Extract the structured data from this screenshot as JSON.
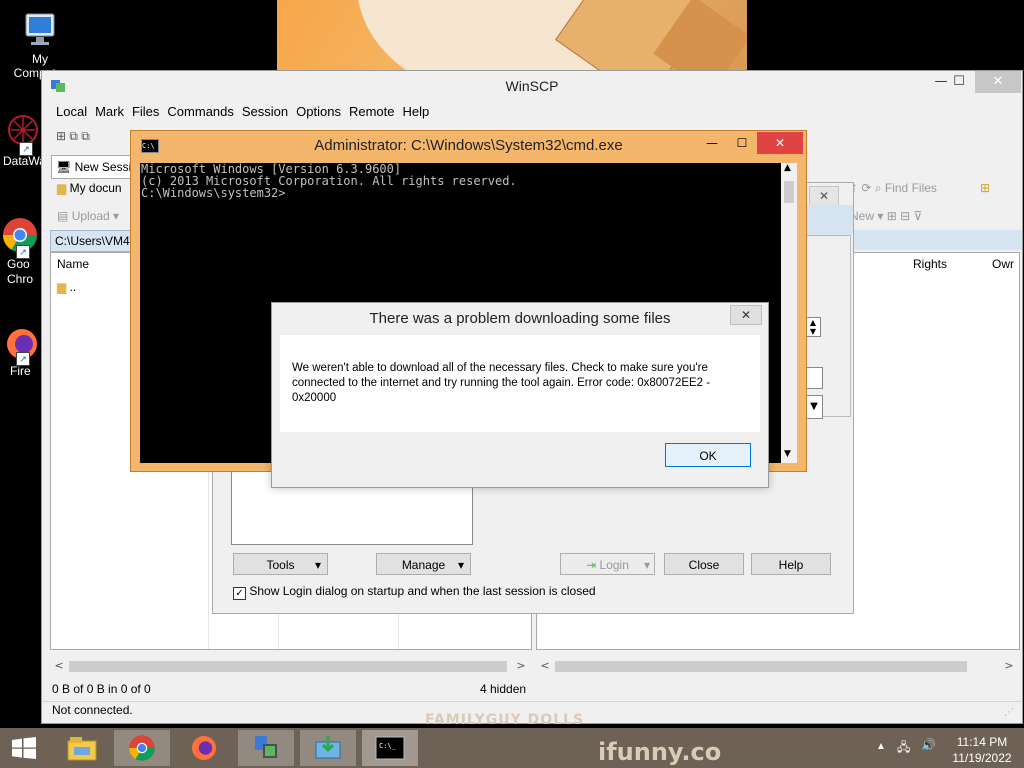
{
  "desktop": {
    "icons": [
      {
        "label": "My Computer",
        "icon": "computer-icon"
      },
      {
        "label": "DataWa",
        "icon": "datawarehouse-icon"
      },
      {
        "label": "Goo\nChro",
        "icon": "chrome-icon"
      },
      {
        "label": "Fire",
        "icon": "firefox-icon"
      }
    ]
  },
  "winscp": {
    "title": "WinSCP",
    "menu": [
      "Local",
      "Mark",
      "Files",
      "Commands",
      "Session",
      "Options",
      "Remote",
      "Help"
    ],
    "new_session": "New Sessi",
    "my_documents": "My docun",
    "upload": "Upload",
    "find_files": "Find Files",
    "new_label": "New",
    "local_path": "C:\\Users\\VM4\\",
    "col_name": "Name",
    "parent_dir": "..",
    "col_rights": "Rights",
    "col_owner": "Owr",
    "status_left": "0 B of 0 B in 0 of 0",
    "hidden": "4 hidden",
    "connection": "Not connected."
  },
  "login": {
    "tools": "Tools",
    "manage": "Manage",
    "login": "Login",
    "close": "Close",
    "help": "Help",
    "show_login": "Show Login dialog on startup and when the last session is closed",
    "show_login_checked": true
  },
  "cmd": {
    "title": "Administrator: C:\\Windows\\System32\\cmd.exe",
    "lines": [
      "Microsoft Windows [Version 6.3.9600]",
      "(c) 2013 Microsoft Corporation. All rights reserved.",
      "C:\\Windows\\system32>"
    ]
  },
  "error_dialog": {
    "title": "There was a problem downloading some files",
    "message": "We weren't able to download all of the necessary files. Check to make sure you're connected to the internet and try running the tool again. Error code: 0x80072EE2 - 0x20000",
    "ok": "OK"
  },
  "taskbar": {
    "time": "11:14 PM",
    "date": "11/19/2022",
    "watermark_site": "ifunny.co",
    "watermark_top": "FAMILYGUY DOLLS"
  },
  "colors": {
    "cmd_frame": "#f4b66b",
    "taskbar": "#6e6256",
    "path_bar": "#d7e4f2",
    "ok_border": "#0078d7"
  }
}
